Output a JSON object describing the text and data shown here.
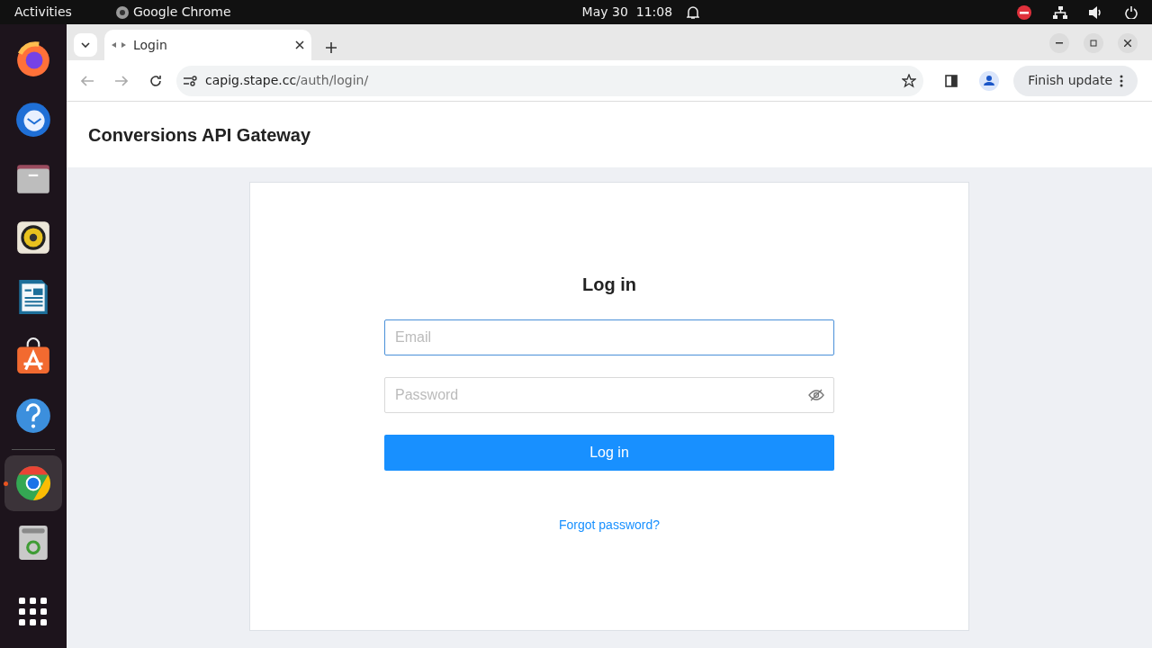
{
  "topbar": {
    "activities": "Activities",
    "app_name": "Google Chrome",
    "clock": "May 30  11:08"
  },
  "dock": [
    {
      "kind": "firefox",
      "selected": false
    },
    {
      "kind": "mail",
      "selected": false
    },
    {
      "kind": "files",
      "selected": false
    },
    {
      "kind": "speaker",
      "selected": false
    },
    {
      "kind": "writer",
      "selected": false
    },
    {
      "kind": "store",
      "selected": false
    },
    {
      "kind": "help",
      "selected": false
    },
    {
      "kind": "chrome",
      "selected": true
    },
    {
      "kind": "trash",
      "selected": false
    }
  ],
  "browser": {
    "tab_title": "Login",
    "url_host": "capig.stape.cc",
    "url_path": "/auth/login/",
    "update_button": "Finish update"
  },
  "page": {
    "brand": "Conversions API Gateway",
    "heading": "Log in",
    "fields": [
      {
        "kind": "email",
        "placeholder": "Email",
        "focused": true
      },
      {
        "kind": "password",
        "placeholder": "Password",
        "focused": false
      }
    ],
    "submit": "Log in",
    "forgot_link": "Forgot password?"
  }
}
